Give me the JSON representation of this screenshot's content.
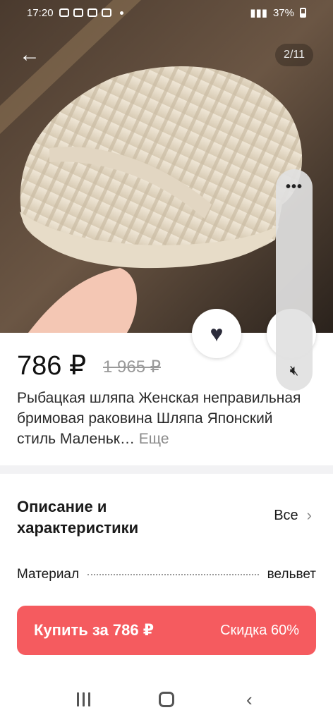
{
  "status": {
    "time": "17:20",
    "battery": "37%"
  },
  "gallery": {
    "counter": "2/11"
  },
  "icons": {
    "back": "arrow-left-icon",
    "favorite": "heart-icon",
    "more": "more-dots-icon",
    "mute": "volume-mute-icon",
    "chevron": "chevron-right-icon"
  },
  "product": {
    "price": "786 ₽",
    "old_price": "1 965 ₽",
    "title": "Рыбацкая шляпа Женская неправильная бримовая раковина Шляпа Японский стиль Маленьк…",
    "title_more": "Еще"
  },
  "description": {
    "title": "Описание и характеристики",
    "all_label": "Все",
    "specs": [
      {
        "name": "Материал",
        "value": "вельвет"
      }
    ]
  },
  "buy": {
    "label": "Купить за 786 ₽",
    "discount": "Скидка 60%",
    "color": "#f55b5f"
  }
}
